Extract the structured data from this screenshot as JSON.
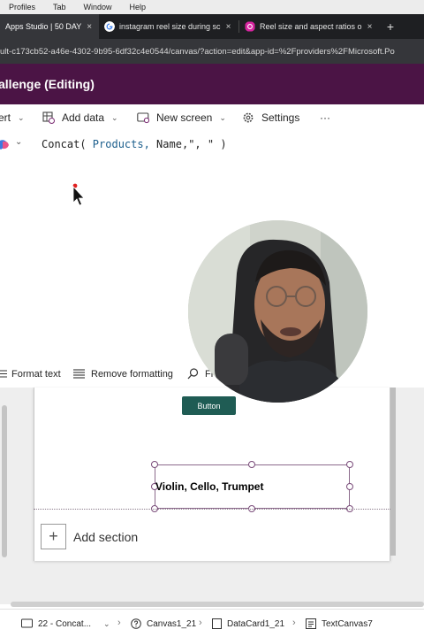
{
  "menubar": {
    "items": [
      "Profiles",
      "Tab",
      "Window",
      "Help"
    ]
  },
  "browser": {
    "tabs": [
      {
        "label": "Apps Studio | 50 DAY",
        "close": "×",
        "active": true
      },
      {
        "label": "instagram reel size during sc",
        "close": "×",
        "active": false
      },
      {
        "label": "Reel size and aspect ratios o",
        "close": "×",
        "active": false
      }
    ],
    "new_tab": "+",
    "url": "ult-c173cb52-a46e-4302-9b95-6df32c4e0544/canvas/?action=edit&app-id=%2Fproviders%2FMicrosoft.Po"
  },
  "app": {
    "title": "allenge (Editing)"
  },
  "commandbar": {
    "insert_label": "ert",
    "add_data_label": "Add data",
    "new_screen_label": "New screen",
    "settings_label": "Settings",
    "more_label": "···"
  },
  "formula": {
    "fn": "Concat(",
    "arg1": " Products,",
    "arg2": " Name,",
    "arg3": "\", \"",
    "close": ")"
  },
  "textformat": {
    "format_text": "Format text",
    "remove_formatting": "Remove formatting",
    "find": "Fi"
  },
  "canvas": {
    "button_label": "Button",
    "text_value": "Violin, Cello, Trumpet",
    "add_section": "Add section",
    "add_section_plus": "+"
  },
  "breadcrumbs": [
    {
      "label": "22 - Concat..."
    },
    {
      "label": "Canvas1_21"
    },
    {
      "label": "DataCard1_21"
    },
    {
      "label": "TextCanvas7"
    }
  ],
  "colors": {
    "titlebar": "#4b1445",
    "button": "#1f5c54",
    "browser_chrome": "#1e1f22"
  }
}
